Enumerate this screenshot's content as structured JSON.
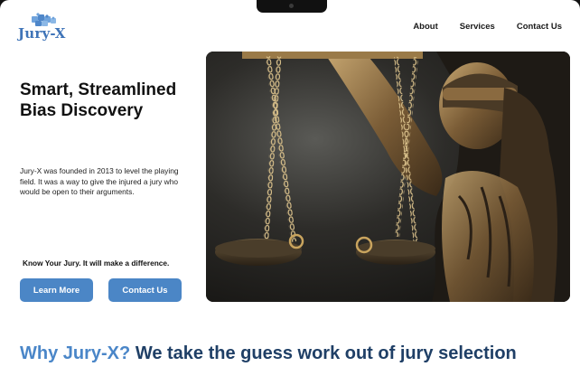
{
  "brand": {
    "name": "Jury-X",
    "color": "#3f74b8"
  },
  "nav": {
    "items": [
      "About",
      "Services",
      "Contact Us"
    ]
  },
  "hero": {
    "title": "Smart, Streamlined Bias Discovery",
    "description": "Jury-X was founded in 2013 to level the playing field. It was a way to give the injured a jury who would be open to their arguments.",
    "tagline": "Know Your Jury. It will make a difference.",
    "buttons": {
      "learn_more": "Learn More",
      "contact_us": "Contact Us"
    },
    "image": "lady-justice-scales-photo"
  },
  "why": {
    "highlight": "Why Jury-X?",
    "rest": "We take the guess work out of jury selection"
  },
  "colors": {
    "accent": "#4b86c6",
    "heading_dark": "#1f3f66"
  }
}
